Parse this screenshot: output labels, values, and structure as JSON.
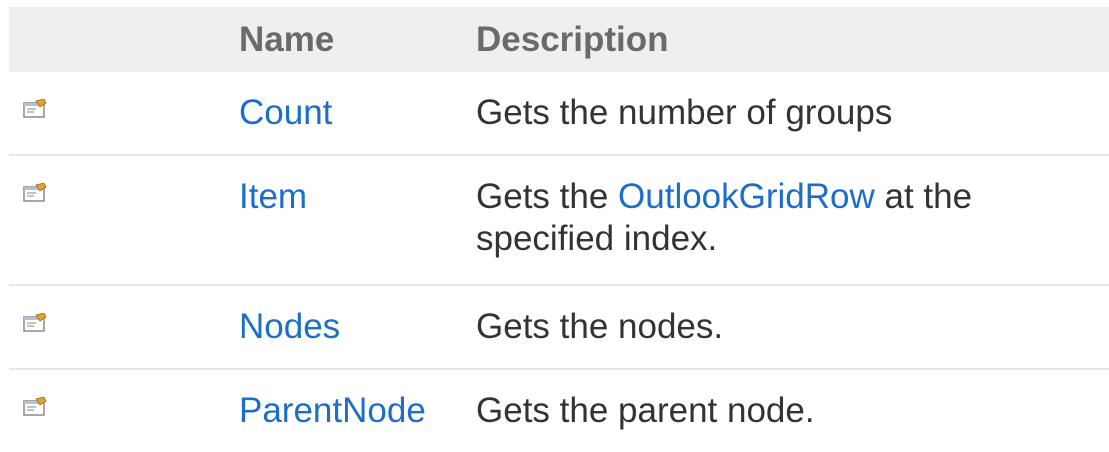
{
  "table": {
    "headers": {
      "icon": "",
      "name": "Name",
      "description": "Description"
    },
    "rows": [
      {
        "icon": "property-icon",
        "name": "Count",
        "description": [
          "Gets the number of groups"
        ]
      },
      {
        "icon": "property-icon",
        "name": "Item",
        "description_prefix": "Gets the ",
        "description_link": "OutlookGridRow",
        "description_suffix": " at the specified index."
      },
      {
        "icon": "property-icon",
        "name": "Nodes",
        "description": [
          "Gets the nodes."
        ]
      },
      {
        "icon": "property-icon",
        "name": "ParentNode",
        "description": [
          "Gets the parent node."
        ]
      }
    ]
  },
  "colors": {
    "header_bg": "#efefef",
    "header_text": "#6a6a6a",
    "link": "#1c6ec9",
    "body_text": "#333333",
    "row_divider": "#e6e6e6"
  }
}
